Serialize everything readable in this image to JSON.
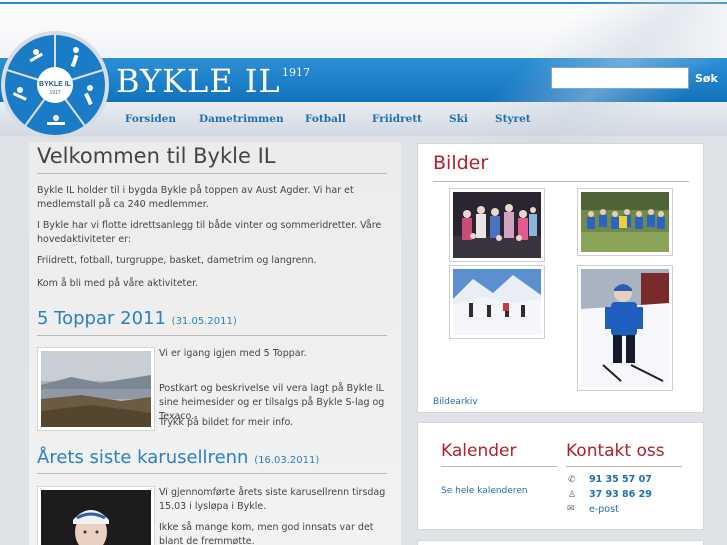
{
  "site": {
    "title": "BYKLE IL",
    "year": "1917",
    "logo_text": "BYKLE IL",
    "logo_year": "1917"
  },
  "search": {
    "placeholder": "",
    "button_label": "Søk"
  },
  "nav": {
    "items": [
      {
        "label": "Forsiden"
      },
      {
        "label": "Dametrimmen"
      },
      {
        "label": "Fotball"
      },
      {
        "label": "Friidrett"
      },
      {
        "label": "Ski"
      },
      {
        "label": "Styret"
      }
    ]
  },
  "welcome": {
    "heading": "Velkommen til Bykle IL",
    "p1": "Bykle IL holder til i bygda Bykle på toppen av Aust Agder. Vi har et medlemstall på ca 240 medlemmer.",
    "p2": "I Bykle har vi flotte idrettsanlegg til både vinter og sommeridretter. Våre hovedaktiviteter er:",
    "p3": "Friidrett, fotball, turgruppe, basket, dametrim og langrenn.",
    "p4": "Kom å bli med på våre aktiviteter."
  },
  "articles": [
    {
      "title": "5 Toppar 2011",
      "date": "(31.05.2011)",
      "p1": "Vi er igang igjen med 5 Toppar.",
      "p2": "Postkart og beskrivelse vil vera lagt på Bykle IL sine heimesider og er tilsalgs på Bykle S-lag og Texaco.",
      "p3": "Trykk på bildet for meir info."
    },
    {
      "title": "Årets siste karusellrenn",
      "date": "(16.03.2011)",
      "p1": "Vi gjennomførte årets siste karusellrenn tirsdag 15.03 i lysløpa i Bykle.",
      "p2": "Ikke så mange kom, men god innsats var det blant de fremmøtte."
    }
  ],
  "gallery": {
    "title": "Bilder",
    "archive_link": "Bildearkiv"
  },
  "calendar": {
    "title": "Kalender",
    "link": "Se hele kalenderen"
  },
  "contact": {
    "title": "Kontakt oss",
    "phone1": "91 35 57 07",
    "phone2": "37 93 86 29",
    "email": "e-post"
  },
  "colors": {
    "brand_blue": "#1a7cc6",
    "heading_red": "#b3202a",
    "link_blue": "#1f6fb0"
  }
}
